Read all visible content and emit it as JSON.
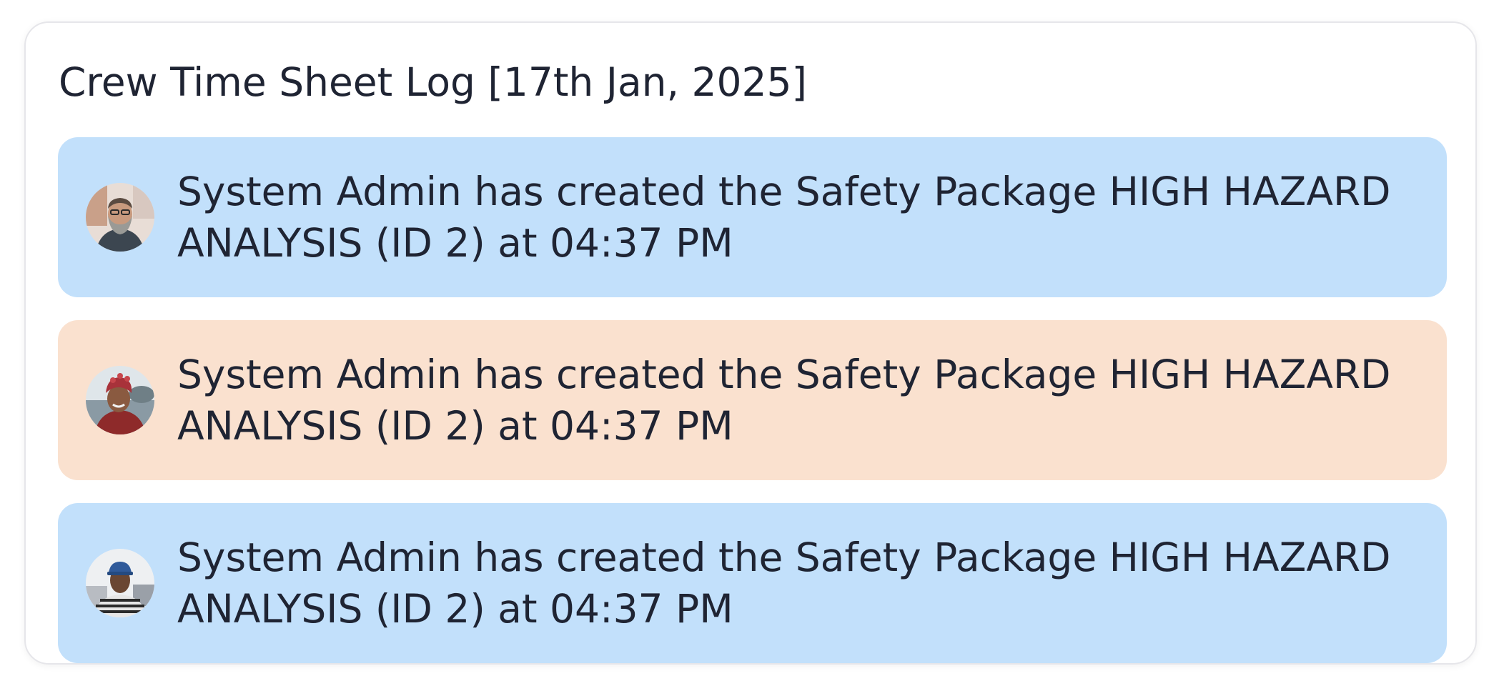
{
  "panel": {
    "title": "Crew Time Sheet Log [17th Jan, 2025]"
  },
  "log_entries": [
    {
      "text": "System Admin has created the Safety Package HIGH HAZARD ANALYSIS (ID 2) at 04:37 PM",
      "color": "#c2e0fb",
      "avatar_icon": "bearded-man-avatar"
    },
    {
      "text": "System Admin has created the Safety Package HIGH HAZARD ANALYSIS (ID 2) at 04:37 PM",
      "color": "#fae1cf",
      "avatar_icon": "woman-headwrap-avatar"
    },
    {
      "text": "System Admin has created the Safety Package HIGH HAZARD ANALYSIS (ID 2) at 04:37 PM",
      "color": "#c2e0fb",
      "avatar_icon": "person-cap-avatar"
    }
  ]
}
